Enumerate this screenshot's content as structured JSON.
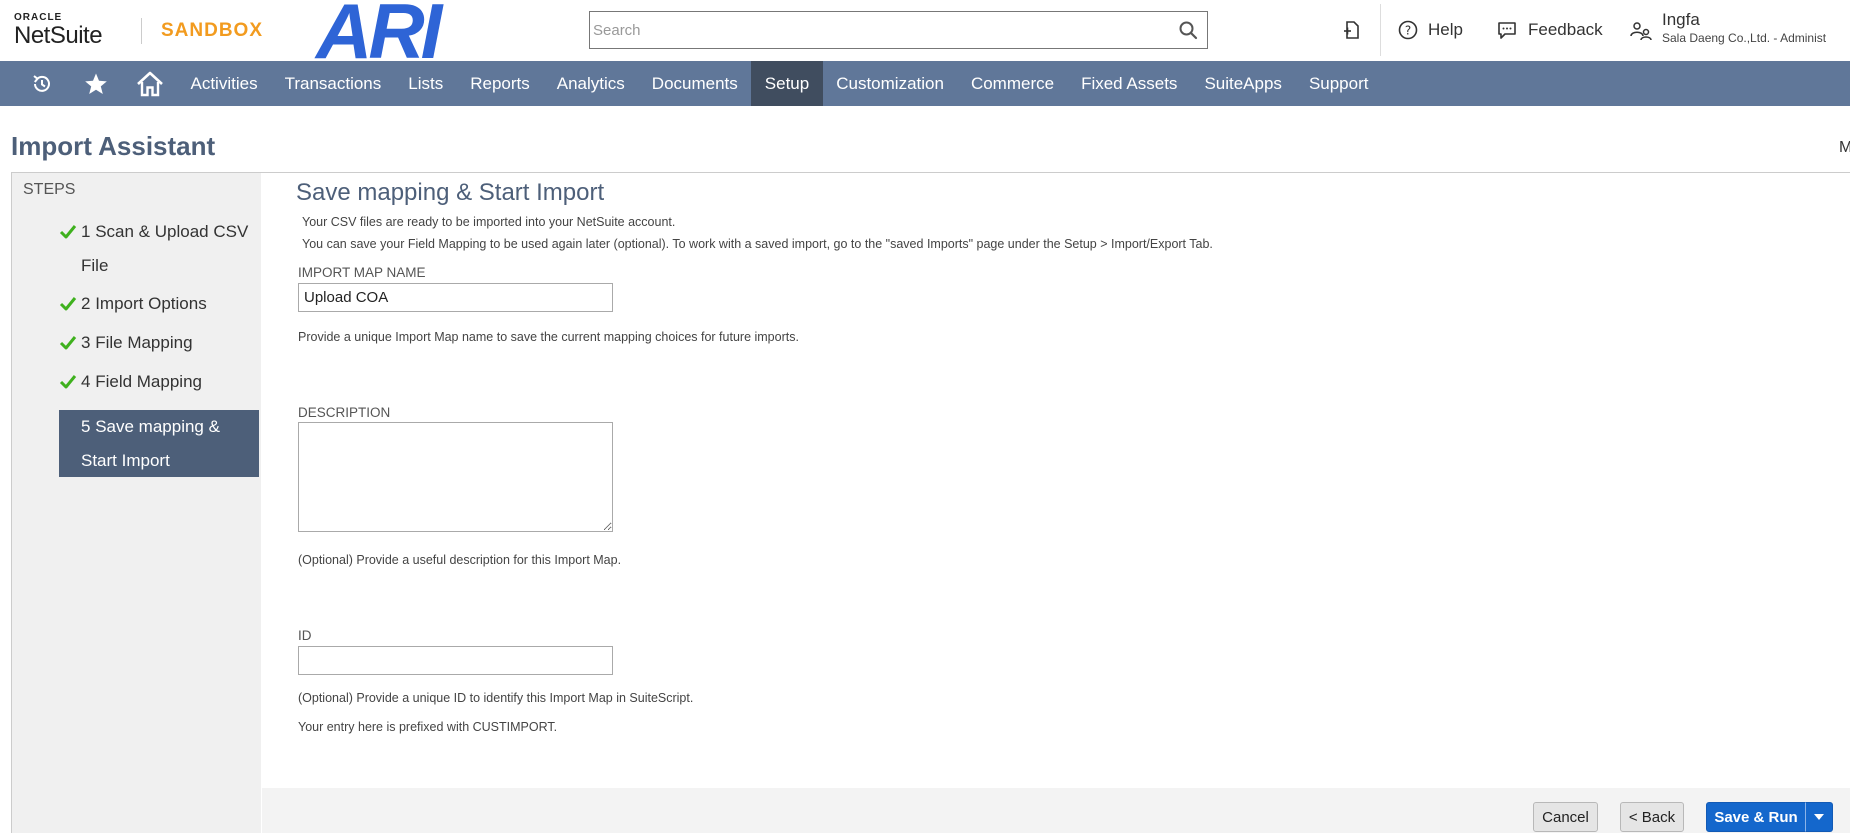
{
  "header": {
    "brand_small": "ORACLE",
    "brand": "NetSuite",
    "environment": "SANDBOX",
    "company_logo_text": "ARI",
    "search_placeholder": "Search",
    "help_label": "Help",
    "feedback_label": "Feedback",
    "user_name": "Ingfa",
    "user_role": "Sala Daeng Co.,Ltd. - Administ"
  },
  "nav": {
    "tabs": [
      {
        "label": "Activities"
      },
      {
        "label": "Transactions"
      },
      {
        "label": "Lists"
      },
      {
        "label": "Reports"
      },
      {
        "label": "Analytics"
      },
      {
        "label": "Documents"
      },
      {
        "label": "Setup",
        "active": true
      },
      {
        "label": "Customization"
      },
      {
        "label": "Commerce"
      },
      {
        "label": "Fixed Assets"
      },
      {
        "label": "SuiteApps"
      },
      {
        "label": "Support"
      }
    ]
  },
  "page": {
    "title": "Import Assistant",
    "right_edge_text": "M"
  },
  "steps": {
    "title": "STEPS",
    "items": [
      {
        "number": "1",
        "label": "Scan & Upload CSV File",
        "completed": true
      },
      {
        "number": "2",
        "label": "Import Options",
        "completed": true
      },
      {
        "number": "3",
        "label": "File Mapping",
        "completed": true
      },
      {
        "number": "4",
        "label": "Field Mapping",
        "completed": true
      },
      {
        "number": "5",
        "label": "Save mapping & Start Import",
        "completed": false,
        "active": true
      }
    ]
  },
  "main": {
    "section_title": "Save mapping & Start Import",
    "intro_line1": "Your CSV files are ready to be imported into your NetSuite account.",
    "intro_line2": "You can save your Field Mapping to be used again later (optional). To work with a saved import, go to the \"saved Imports\" page under the Setup > Import/Export Tab.",
    "import_map_name": {
      "label": "IMPORT MAP NAME",
      "value": "Upload COA",
      "help": "Provide a unique Import Map name to save the current mapping choices for future imports."
    },
    "description": {
      "label": "DESCRIPTION",
      "value": "",
      "help": "(Optional) Provide a useful description for this Import Map."
    },
    "id_field": {
      "label": "ID",
      "value": "",
      "help1": "(Optional) Provide a unique ID to identify this Import Map in SuiteScript.",
      "help2": "Your entry here is prefixed with CUSTIMPORT."
    }
  },
  "footer": {
    "cancel_label": "Cancel",
    "back_label": "< Back",
    "save_run_label": "Save & Run"
  },
  "colors": {
    "nav_bg": "#607799",
    "nav_active": "#404d5f",
    "title": "#4d5f79",
    "sandbox": "#f29b1f",
    "primary_button": "#1467cc",
    "check": "#3fb11e"
  }
}
